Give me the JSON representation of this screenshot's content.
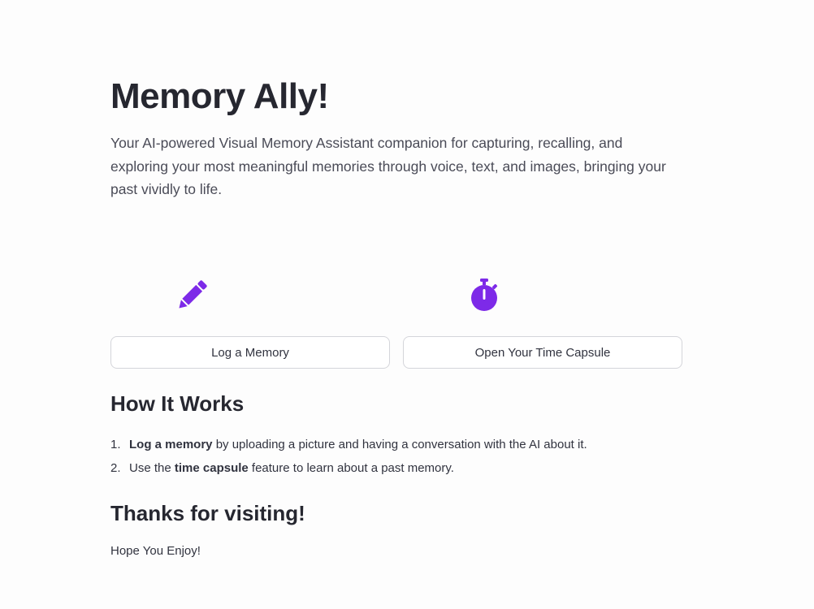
{
  "header": {
    "title": "Memory Ally!",
    "description": "Your AI-powered Visual Memory Assistant companion for capturing, recalling, and exploring your most meaningful memories through voice, text, and images, bringing your past vividly to life."
  },
  "actions": [
    {
      "icon": "pencil-icon",
      "label": "Log a Memory"
    },
    {
      "icon": "stopwatch-icon",
      "label": "Open Your Time Capsule"
    }
  ],
  "how_it_works": {
    "heading": "How It Works",
    "steps": [
      {
        "number": "1.",
        "prefix": "",
        "bold": "Log a memory",
        "suffix": " by uploading a picture and having a conversation with the AI about it."
      },
      {
        "number": "2.",
        "prefix": "Use the ",
        "bold": "time capsule",
        "suffix": " feature to learn about a past memory."
      }
    ]
  },
  "thanks": {
    "heading": "Thanks for visiting!",
    "text": "Hope You Enjoy!"
  },
  "colors": {
    "accent": "#7d2ae8",
    "text": "#31333f",
    "heading": "#262730",
    "button_border": "#d4d5da",
    "background": "#fdfdfd"
  }
}
